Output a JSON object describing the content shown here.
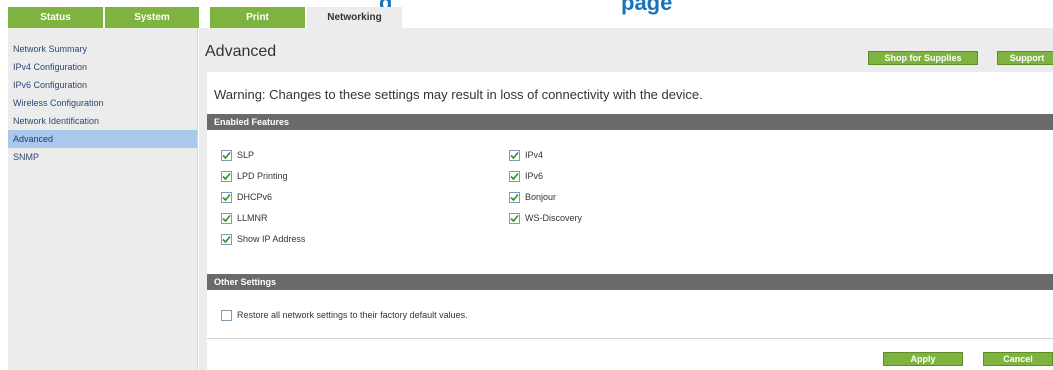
{
  "header": {
    "title_fragment": "g",
    "title_fragment_right": "page"
  },
  "tabs": [
    {
      "label": "Status"
    },
    {
      "label": "System"
    },
    {
      "label": "Print"
    },
    {
      "label": "Networking"
    }
  ],
  "sidebar": {
    "items": [
      {
        "label": "Network Summary"
      },
      {
        "label": "IPv4 Configuration"
      },
      {
        "label": "IPv6 Configuration"
      },
      {
        "label": "Wireless Configuration"
      },
      {
        "label": "Network Identification"
      },
      {
        "label": "Advanced"
      },
      {
        "label": "SNMP"
      }
    ],
    "active_index": 5
  },
  "main": {
    "page_title": "Advanced",
    "shop_label": "Shop for Supplies",
    "support_label": "Support",
    "warning": "Warning: Changes to these settings may result in loss of connectivity with the device.",
    "enabled_section": "Enabled Features",
    "features_left": [
      {
        "label": "SLP",
        "checked": true
      },
      {
        "label": "LPD Printing",
        "checked": true
      },
      {
        "label": "DHCPv6",
        "checked": true
      },
      {
        "label": "LLMNR",
        "checked": true
      },
      {
        "label": "Show IP Address",
        "checked": true
      }
    ],
    "features_right": [
      {
        "label": "IPv4",
        "checked": true
      },
      {
        "label": "IPv6",
        "checked": true
      },
      {
        "label": "Bonjour",
        "checked": true
      },
      {
        "label": "WS-Discovery",
        "checked": true
      }
    ],
    "other_section": "Other Settings",
    "restore_label": "Restore all network settings to their factory default values.",
    "restore_checked": false,
    "apply_label": "Apply",
    "cancel_label": "Cancel"
  },
  "colors": {
    "accent_green": "#7fb33f",
    "section_bar": "#6a6a6a",
    "active_nav": "#a9c9ec",
    "title_blue": "#1a73b8"
  }
}
